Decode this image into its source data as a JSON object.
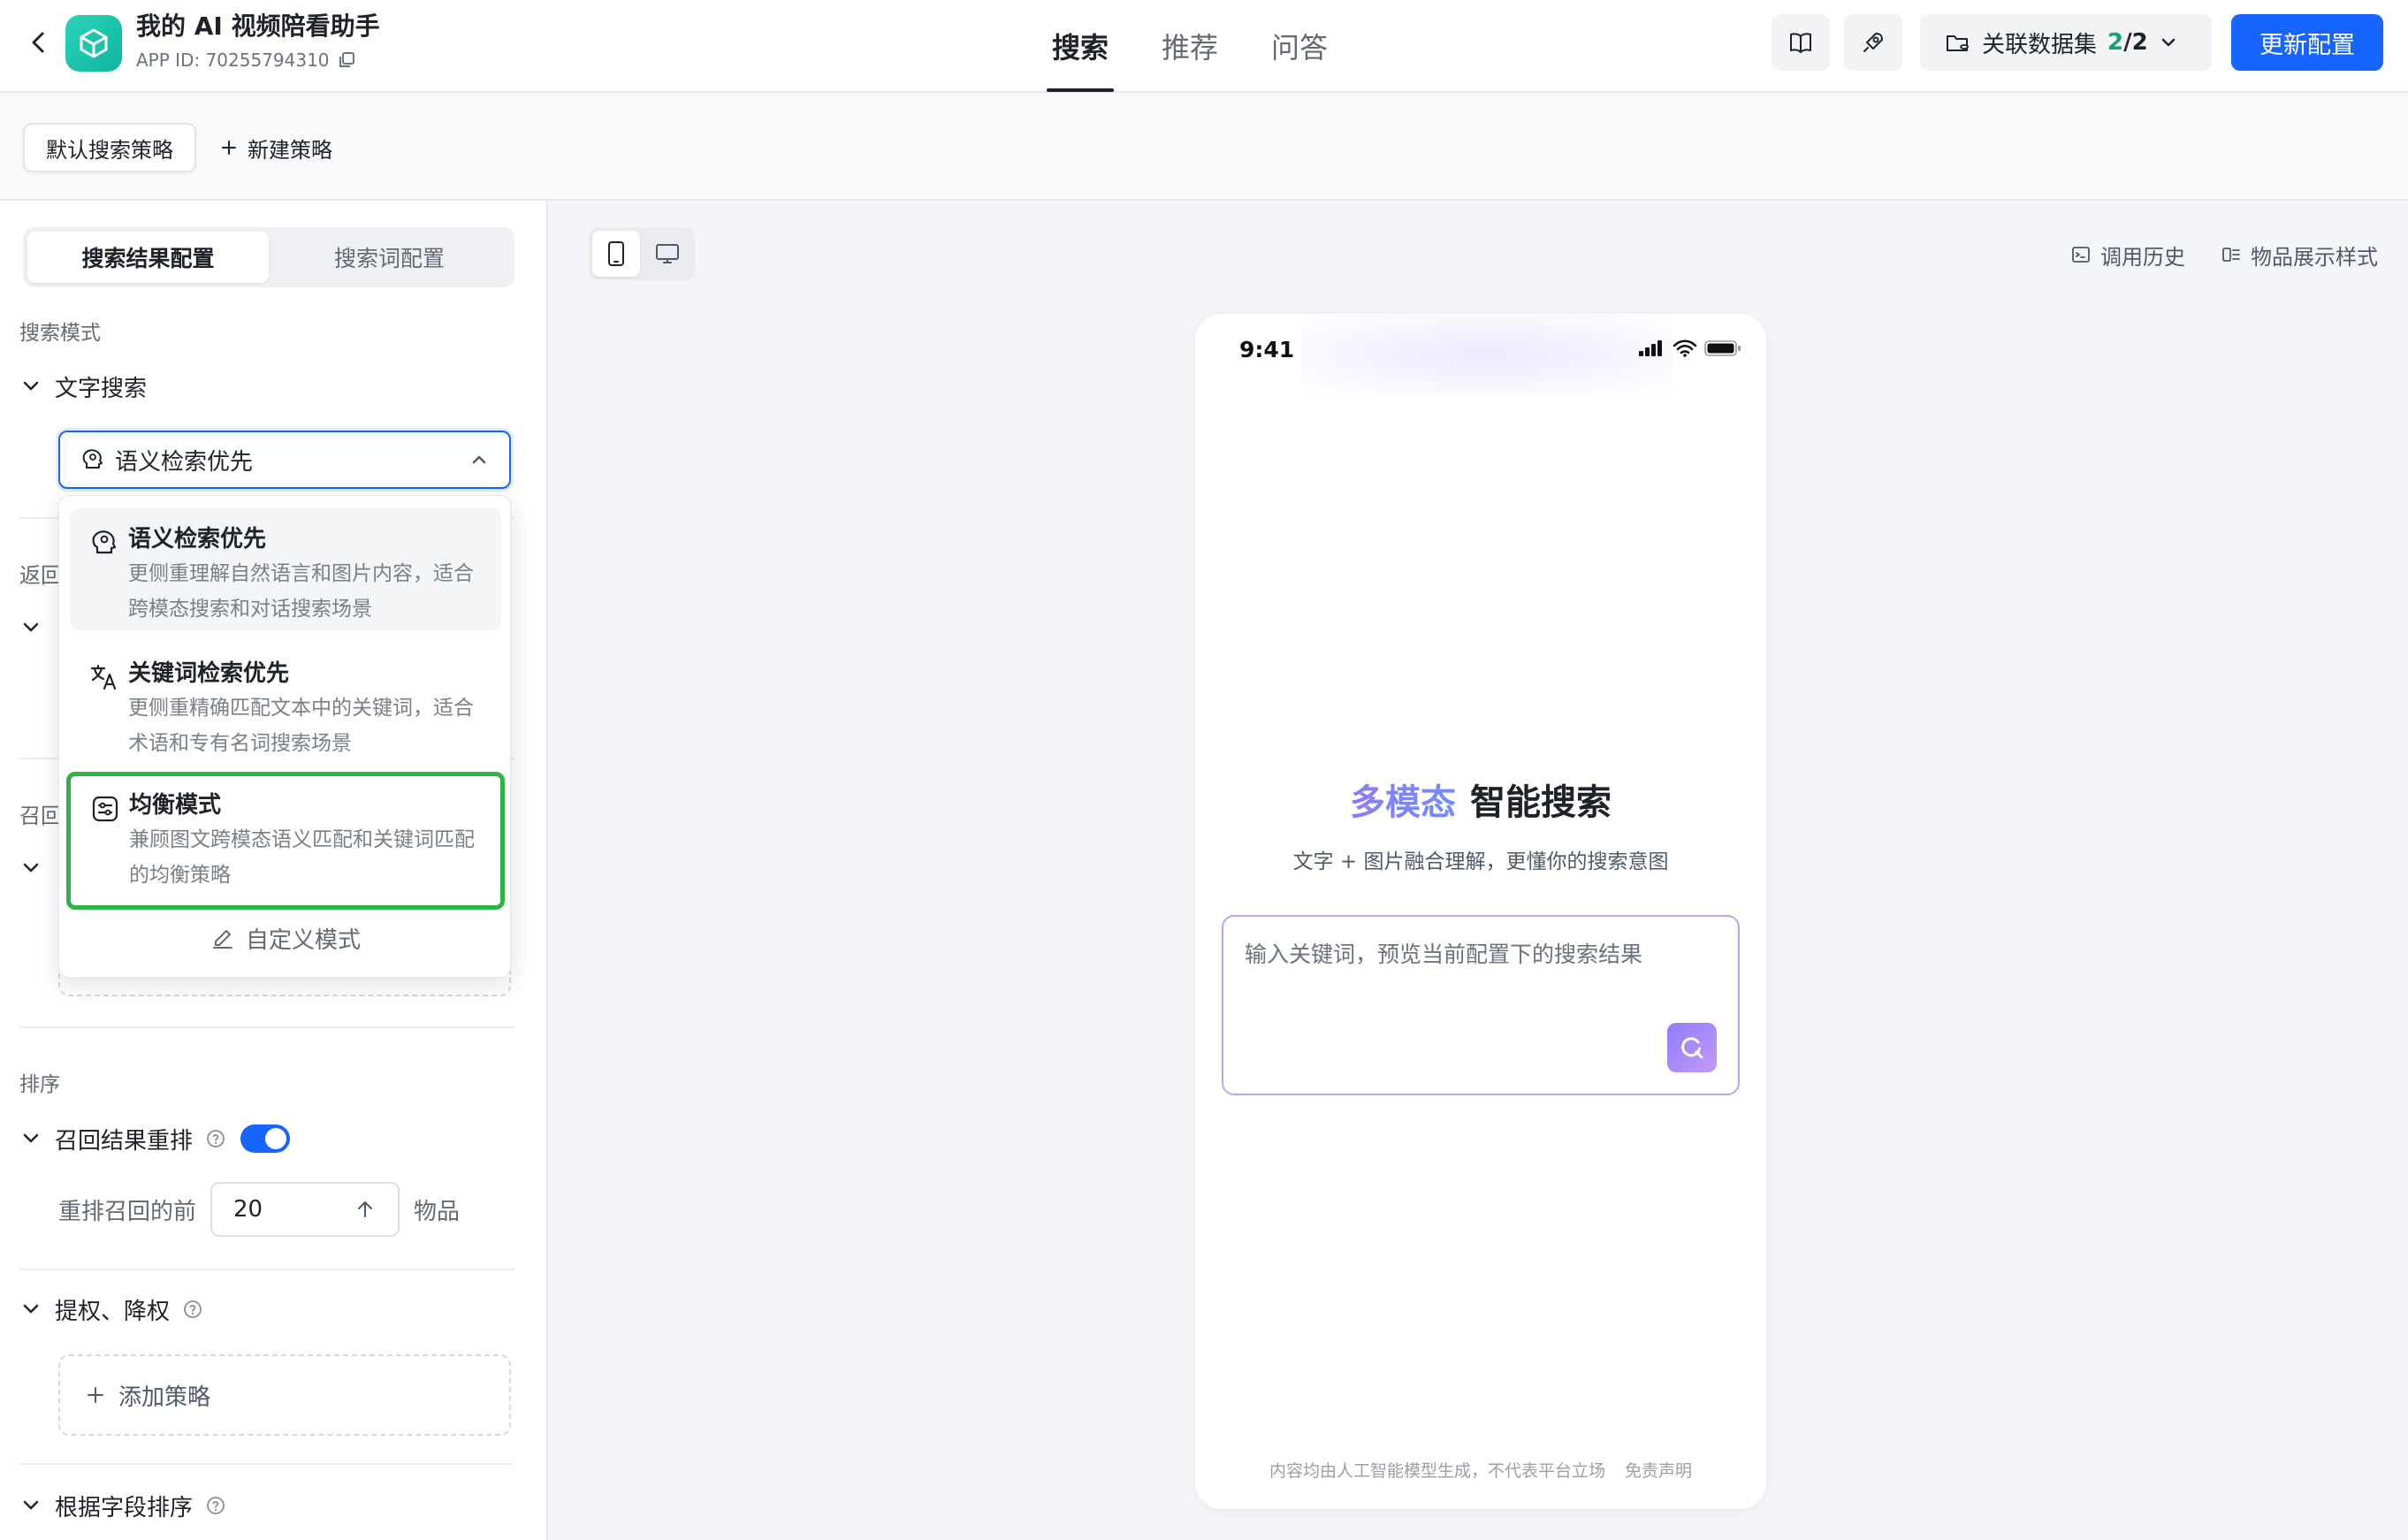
{
  "header": {
    "app_name": "我的 AI 视频陪看助手",
    "app_id": "APP ID: 70255794310",
    "tabs": [
      {
        "label": "搜索",
        "active": true
      },
      {
        "label": "推荐",
        "active": false
      },
      {
        "label": "问答",
        "active": false
      }
    ],
    "dataset_label": "关联数据集",
    "dataset_count_used": "2",
    "dataset_count_total": "/2",
    "update_button": "更新配置"
  },
  "strategy_bar": {
    "default_strategy": "默认搜索策略",
    "new_strategy": "新建策略"
  },
  "left_panel": {
    "segments": [
      {
        "label": "搜索结果配置",
        "active": true
      },
      {
        "label": "搜索词配置",
        "active": false
      }
    ],
    "search_mode_label": "搜索模式",
    "text_search_label": "文字搜索",
    "selected_mode": "语义检索优先",
    "partial_label_return": "返回",
    "partial_label_recall": "召回",
    "sort_label": "排序",
    "rerank_label": "召回结果重排",
    "rerank_enabled": true,
    "rerank_prefix": "重排召回的前",
    "rerank_value": "20",
    "rerank_suffix": "物品",
    "boost_label": "提权、降权",
    "add_strategy": "添加策略",
    "field_sort_label": "根据字段排序"
  },
  "dropdown": {
    "options": [
      {
        "title": "语义检索优先",
        "desc": "更侧重理解自然语言和图片内容，适合跨模态搜索和对话搜索场景"
      },
      {
        "title": "关键词检索优先",
        "desc": "更侧重精确匹配文本中的关键词，适合术语和专有名词搜索场景"
      },
      {
        "title": "均衡模式",
        "desc": "兼顾图文跨模态语义匹配和关键词匹配的均衡策略"
      }
    ],
    "custom": "自定义模式"
  },
  "preview": {
    "call_history": "调用历史",
    "display_style": "物品展示样式",
    "phone": {
      "time": "9:41",
      "hero_highlight": "多模态",
      "hero_title": "智能搜索",
      "hero_subtitle": "文字 + 图片融合理解，更懂你的搜索意图",
      "search_placeholder": "输入关键词，预览当前配置下的搜索结果",
      "disclaimer": "内容均由人工智能模型生成，不代表平台立场",
      "disclaimer_link": "免责声明"
    }
  },
  "colors": {
    "primary": "#1764ff",
    "highlight_box": "#2fb344",
    "accent_purple": "#8b7cf6"
  }
}
